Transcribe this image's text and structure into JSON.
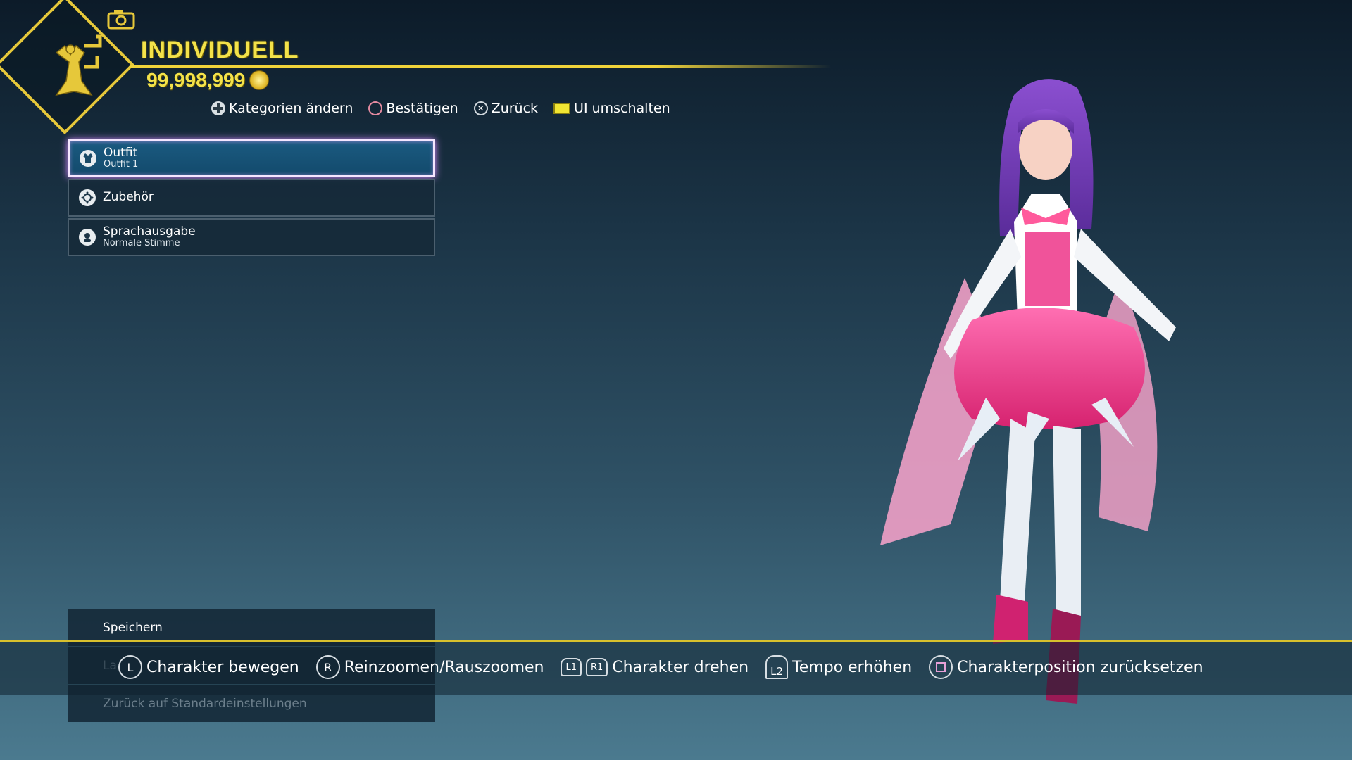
{
  "header": {
    "title": "INDIVIDUELL",
    "currency_value": "99,998,999",
    "emblem_icon": "costume-emblem-icon",
    "camera_icon": "camera-icon",
    "accent_color": "#f3e24a"
  },
  "hints_top": [
    {
      "icon": "dpad-icon",
      "label": "Kategorien ändern"
    },
    {
      "icon": "circle-button-icon",
      "label": "Bestätigen"
    },
    {
      "icon": "cross-button-icon",
      "label": "Zurück"
    },
    {
      "icon": "touchpad-icon",
      "label": "UI umschalten"
    }
  ],
  "menu": {
    "items": [
      {
        "label": "Outfit",
        "sub": "Outfit 1",
        "icon": "outfit-icon",
        "selected": true
      },
      {
        "label": "Zubehör",
        "sub": "",
        "icon": "accessory-icon",
        "selected": false
      },
      {
        "label": "Sprachausgabe",
        "sub": "Normale Stimme",
        "icon": "voice-icon",
        "selected": false
      }
    ]
  },
  "bottom_menu": {
    "save": "Speichern",
    "load_partial": "La",
    "reset": "Zurück auf Standardeinstellungen"
  },
  "controls": [
    {
      "key": "L",
      "label": "Charakter bewegen"
    },
    {
      "key": "R",
      "label": "Reinzoomen/Rauszoomen"
    },
    {
      "key": "L1",
      "key2": "R1",
      "label": "Charakter drehen"
    },
    {
      "key": "L2",
      "label": "Tempo erhöhen"
    },
    {
      "key": "square",
      "label": "Charakterposition zurücksetzen"
    }
  ]
}
